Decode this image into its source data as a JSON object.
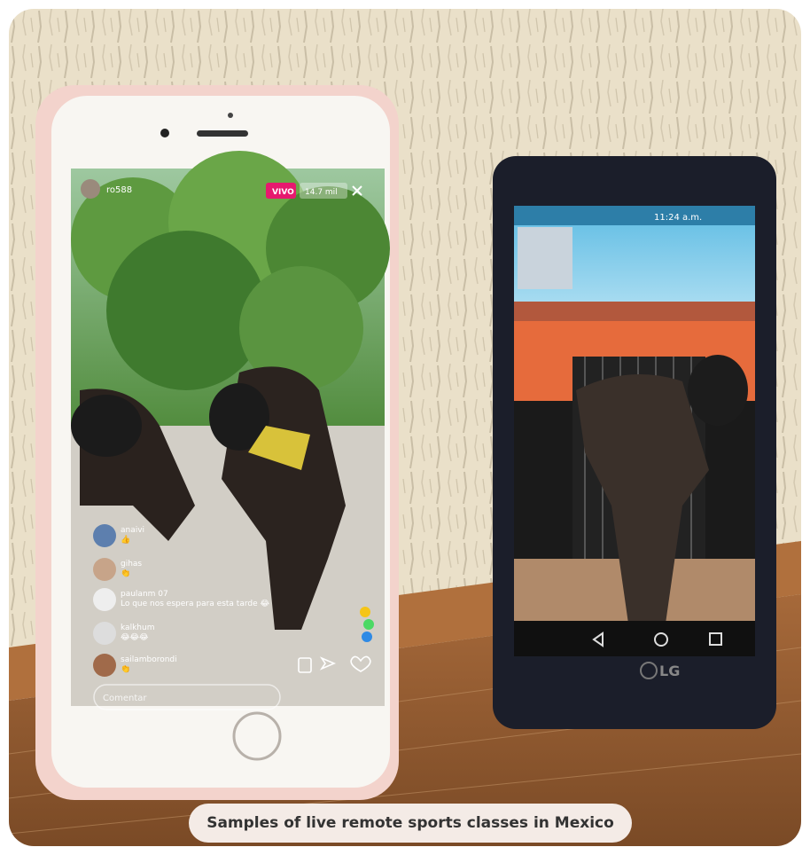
{
  "caption": "Samples of live remote sports classes in Mexico",
  "iphone": {
    "live_badge": "VIVO",
    "viewers": "14.7 mil",
    "username": "ro588",
    "comment_placeholder": "Comentar",
    "comments": [
      {
        "user": "anaivi",
        "text": "👍"
      },
      {
        "user": "gihas",
        "text": "👏"
      },
      {
        "user": "paulanm 07",
        "text": "Lo que nos espera para esta tarde 😂"
      },
      {
        "user": "kalkhum",
        "text": "😂😂😂"
      },
      {
        "user": "sailamborondi",
        "text": "👏"
      }
    ]
  },
  "lg": {
    "status_time": "11:24 a.m.",
    "brand": "LG"
  },
  "colors": {
    "wall": "#e9dfc8",
    "shelf": "#9a5e30",
    "iphone_case": "#f3d3cc",
    "live_red": "#e6196e",
    "lg_body": "#1b1e2a"
  }
}
